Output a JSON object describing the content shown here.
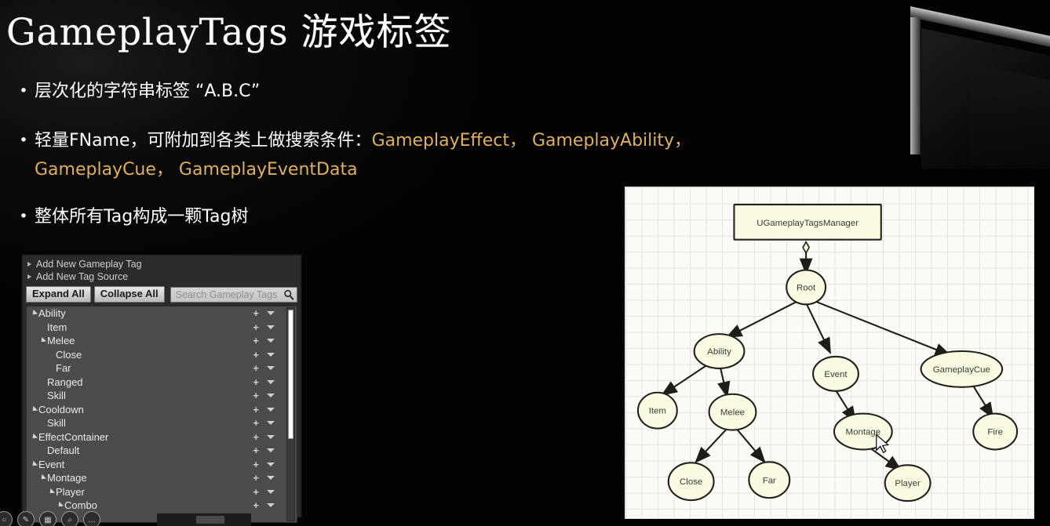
{
  "slide": {
    "title_latin": "GameplayTags",
    "title_cjk": "游戏标签",
    "bullets": [
      {
        "marker": "•",
        "text": "层次化的字符串标签 “A.B.C”"
      }
    ],
    "bullet2": {
      "marker": "•",
      "lead": "轻量FName，可附加到各类上做搜索条件：",
      "highlight1": "GameplayEffect，",
      "highlight2": "GameplayAbility，",
      "highlight3": "GameplayCue，",
      "highlight4": "GameplayEventData",
      "highlight_color": "#e0b05f"
    },
    "bullet3": {
      "marker": "•",
      "text": "整体所有Tag构成一颗Tag树"
    }
  },
  "tag_panel": {
    "add_rows": [
      "Add New Gameplay Tag",
      "Add New Tag Source"
    ],
    "expand_all": "Expand All",
    "collapse_all": "Collapse All",
    "search_placeholder": "Search Gameplay Tags",
    "search_value": "",
    "search_icon": "magnifier-icon",
    "rows": [
      {
        "label": "Ability",
        "indent": 0,
        "expandable": true,
        "plus": "+",
        "caret": "▼"
      },
      {
        "label": "Item",
        "indent": 1,
        "expandable": false,
        "plus": "+",
        "caret": "▼"
      },
      {
        "label": "Melee",
        "indent": 1,
        "expandable": true,
        "plus": "+",
        "caret": "▼"
      },
      {
        "label": "Close",
        "indent": 2,
        "expandable": false,
        "plus": "+",
        "caret": "▼"
      },
      {
        "label": "Far",
        "indent": 2,
        "expandable": false,
        "plus": "+",
        "caret": "▼"
      },
      {
        "label": "Ranged",
        "indent": 1,
        "expandable": false,
        "plus": "+",
        "caret": "▼"
      },
      {
        "label": "Skill",
        "indent": 1,
        "expandable": false,
        "plus": "+",
        "caret": "▼"
      },
      {
        "label": "Cooldown",
        "indent": 0,
        "expandable": true,
        "plus": "+",
        "caret": "▼"
      },
      {
        "label": "Skill",
        "indent": 1,
        "expandable": false,
        "plus": "+",
        "caret": "▼"
      },
      {
        "label": "EffectContainer",
        "indent": 0,
        "expandable": true,
        "plus": "+",
        "caret": "▼"
      },
      {
        "label": "Default",
        "indent": 1,
        "expandable": false,
        "plus": "+",
        "caret": "▼"
      },
      {
        "label": "Event",
        "indent": 0,
        "expandable": true,
        "plus": "+",
        "caret": "▼"
      },
      {
        "label": "Montage",
        "indent": 1,
        "expandable": true,
        "plus": "+",
        "caret": "▼"
      },
      {
        "label": "Player",
        "indent": 2,
        "expandable": true,
        "plus": "+",
        "caret": "▼"
      },
      {
        "label": "Combo",
        "indent": 3,
        "expandable": true,
        "plus": "+",
        "caret": "▼"
      }
    ],
    "mini_toolbar_icons": [
      "circle-icon",
      "pencil-icon",
      "grid-icon",
      "search-icon",
      "ellipsis-icon"
    ]
  },
  "diagram": {
    "manager_box": "UGameplayTagsManager",
    "nodes": {
      "root": "Root",
      "ability": "Ability",
      "item": "Item",
      "melee": "Melee",
      "close": "Close",
      "far": "Far",
      "event": "Event",
      "montage": "Montage",
      "player": "Player",
      "gameplaycue": "GameplayCue",
      "fire": "Fire"
    },
    "node_fill": "#fbfbe3",
    "node_stroke": "#20201c",
    "cursor": "mouse-pointer"
  }
}
